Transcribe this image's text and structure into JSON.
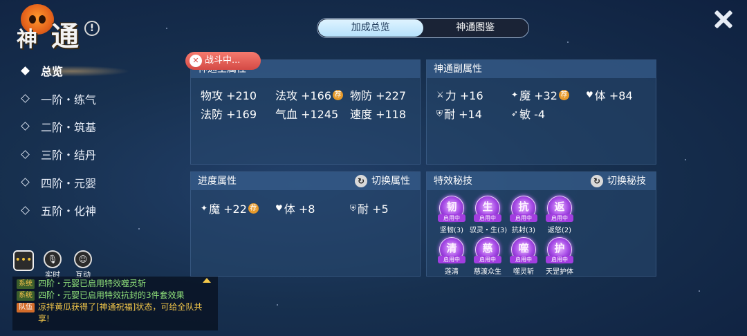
{
  "header": {
    "logo_text": "通",
    "logo_glyph": "神",
    "info_icon": "!",
    "tabs": [
      {
        "label": "加成总览",
        "active": true
      },
      {
        "label": "神通图鉴",
        "active": false
      }
    ]
  },
  "nav": [
    {
      "label": "总览",
      "active": true
    },
    {
      "label": "一阶・练气",
      "active": false
    },
    {
      "label": "二阶・筑基",
      "active": false
    },
    {
      "label": "三阶・结丹",
      "active": false
    },
    {
      "label": "四阶・元婴",
      "active": false
    },
    {
      "label": "五阶・化神",
      "active": false
    }
  ],
  "battle_badge": "战斗中...",
  "main_attr": {
    "title": "神通主属性",
    "stats": [
      {
        "text": "物攻 +210",
        "rec": false
      },
      {
        "text": "法攻 +166",
        "rec": true
      },
      {
        "text": "物防 +227",
        "rec": false
      },
      {
        "text": "法防 +169",
        "rec": false
      },
      {
        "text": "气血 +1245",
        "rec": false
      },
      {
        "text": "速度 +118",
        "rec": false
      }
    ]
  },
  "sub_attr": {
    "title": "神通副属性",
    "stats": [
      {
        "icon": "sword-icon",
        "glyph": "⚔",
        "text": "力 +16",
        "rec": false
      },
      {
        "icon": "wand-icon",
        "glyph": "✦",
        "text": "魔 +32",
        "rec": true
      },
      {
        "icon": "heart-icon",
        "glyph": "♥",
        "text": "体 +84",
        "rec": false
      },
      {
        "icon": "shield-icon",
        "glyph": "⛨",
        "text": "耐 +14",
        "rec": false
      },
      {
        "icon": "boot-icon",
        "glyph": "➶",
        "text": "敏 -4",
        "rec": false
      }
    ]
  },
  "progress_attr": {
    "title": "进度属性",
    "switch_label": "切换属性",
    "stats": [
      {
        "icon": "wand-icon",
        "glyph": "✦",
        "text": "魔 +22",
        "rec": true
      },
      {
        "icon": "heart-icon",
        "glyph": "♥",
        "text": "体 +8",
        "rec": false
      },
      {
        "icon": "shield-icon",
        "glyph": "⛨",
        "text": "耐 +5",
        "rec": false
      }
    ]
  },
  "rec_label": "荐",
  "skills": {
    "title": "特效秘技",
    "switch_label": "切换秘技",
    "status_label": "启用中",
    "items": [
      {
        "glyph": "韧",
        "name": "坚韧(3)"
      },
      {
        "glyph": "生",
        "name": "驭灵・生(3)"
      },
      {
        "glyph": "抗",
        "name": "抗封(3)"
      },
      {
        "glyph": "返",
        "name": "返怒(2)"
      },
      {
        "glyph": "清",
        "name": "莲清"
      },
      {
        "glyph": "慈",
        "name": "慈渡众生"
      },
      {
        "glyph": "噬",
        "name": "噬灵斩"
      },
      {
        "glyph": "护",
        "name": "天罡护体"
      }
    ]
  },
  "chat": {
    "buttons": [
      {
        "label": "",
        "glyph": "•••"
      },
      {
        "label": "实时",
        "glyph": "🎙"
      },
      {
        "label": "互动",
        "glyph": "☺"
      }
    ],
    "messages": [
      {
        "channel": "系统",
        "type": "sys",
        "text": "四阶・元婴已启用特效噬灵斩"
      },
      {
        "channel": "系统",
        "type": "sys",
        "text": "四阶・元婴已启用特效抗封的3件套效果"
      },
      {
        "channel": "队伍",
        "type": "team",
        "text": "凉拌黄瓜获得了[神通祝福]状态，可给全队共享!"
      }
    ]
  }
}
